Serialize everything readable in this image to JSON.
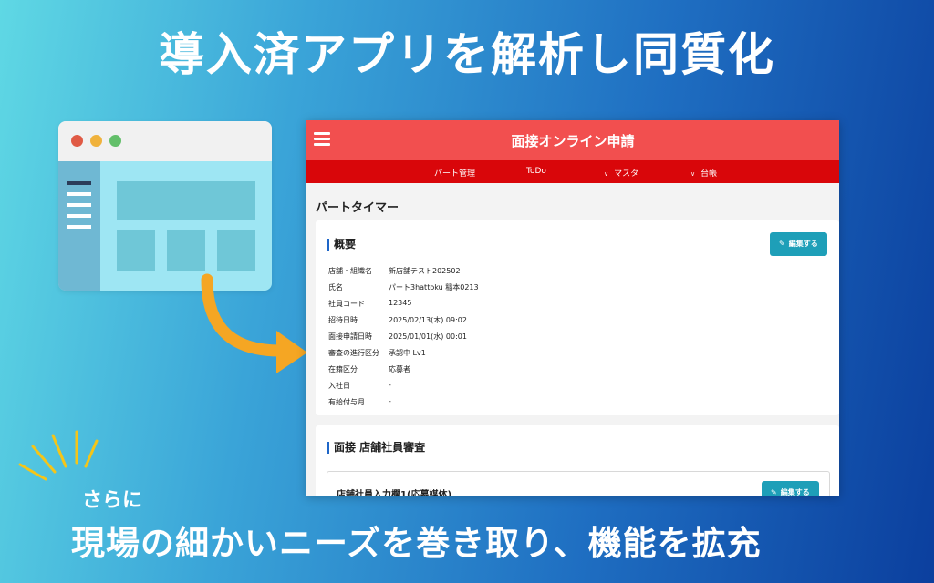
{
  "headline": "導入済アプリを解析し同質化",
  "app": {
    "title": "面接オンライン申請",
    "nav": [
      "パート管理",
      "ToDo",
      "マスタ",
      "台帳"
    ],
    "page_title": "パートタイマー",
    "overview": {
      "heading": "概要",
      "edit_label": "編集する",
      "rows": [
        {
          "label": "店舗・組織名",
          "value": "新店舗テスト202502"
        },
        {
          "label": "氏名",
          "value": "パート3hattoku 稲本0213"
        },
        {
          "label": "社員コード",
          "value": "12345"
        },
        {
          "label": "招待日時",
          "value": "2025/02/13(木) 09:02"
        },
        {
          "label": "面接申請日時",
          "value": "2025/01/01(水) 00:01"
        },
        {
          "label": "審査の進行区分",
          "value": "承認中 Lv1"
        },
        {
          "label": "在籍区分",
          "value": "応募者"
        },
        {
          "label": "入社日",
          "value": "-"
        },
        {
          "label": "有給付与月",
          "value": "-"
        }
      ]
    },
    "review": {
      "heading": "面接 店舗社員審査",
      "subbox_title": "店舗社員入力欄1(応募媒体)",
      "edit_label": "編集する"
    }
  },
  "sub_caption": "さらに",
  "bottom_line": "現場の細かいニーズを巻き取り、機能を拡充",
  "colors": {
    "app_header": "#f24f4f",
    "app_nav": "#d9060a",
    "edit_button": "#1e9fb8",
    "arrow": "#f5a623"
  },
  "icons": [
    "hamburger-icon",
    "pencil-edit-icon",
    "chevron-down-icon",
    "arrow-icon"
  ]
}
